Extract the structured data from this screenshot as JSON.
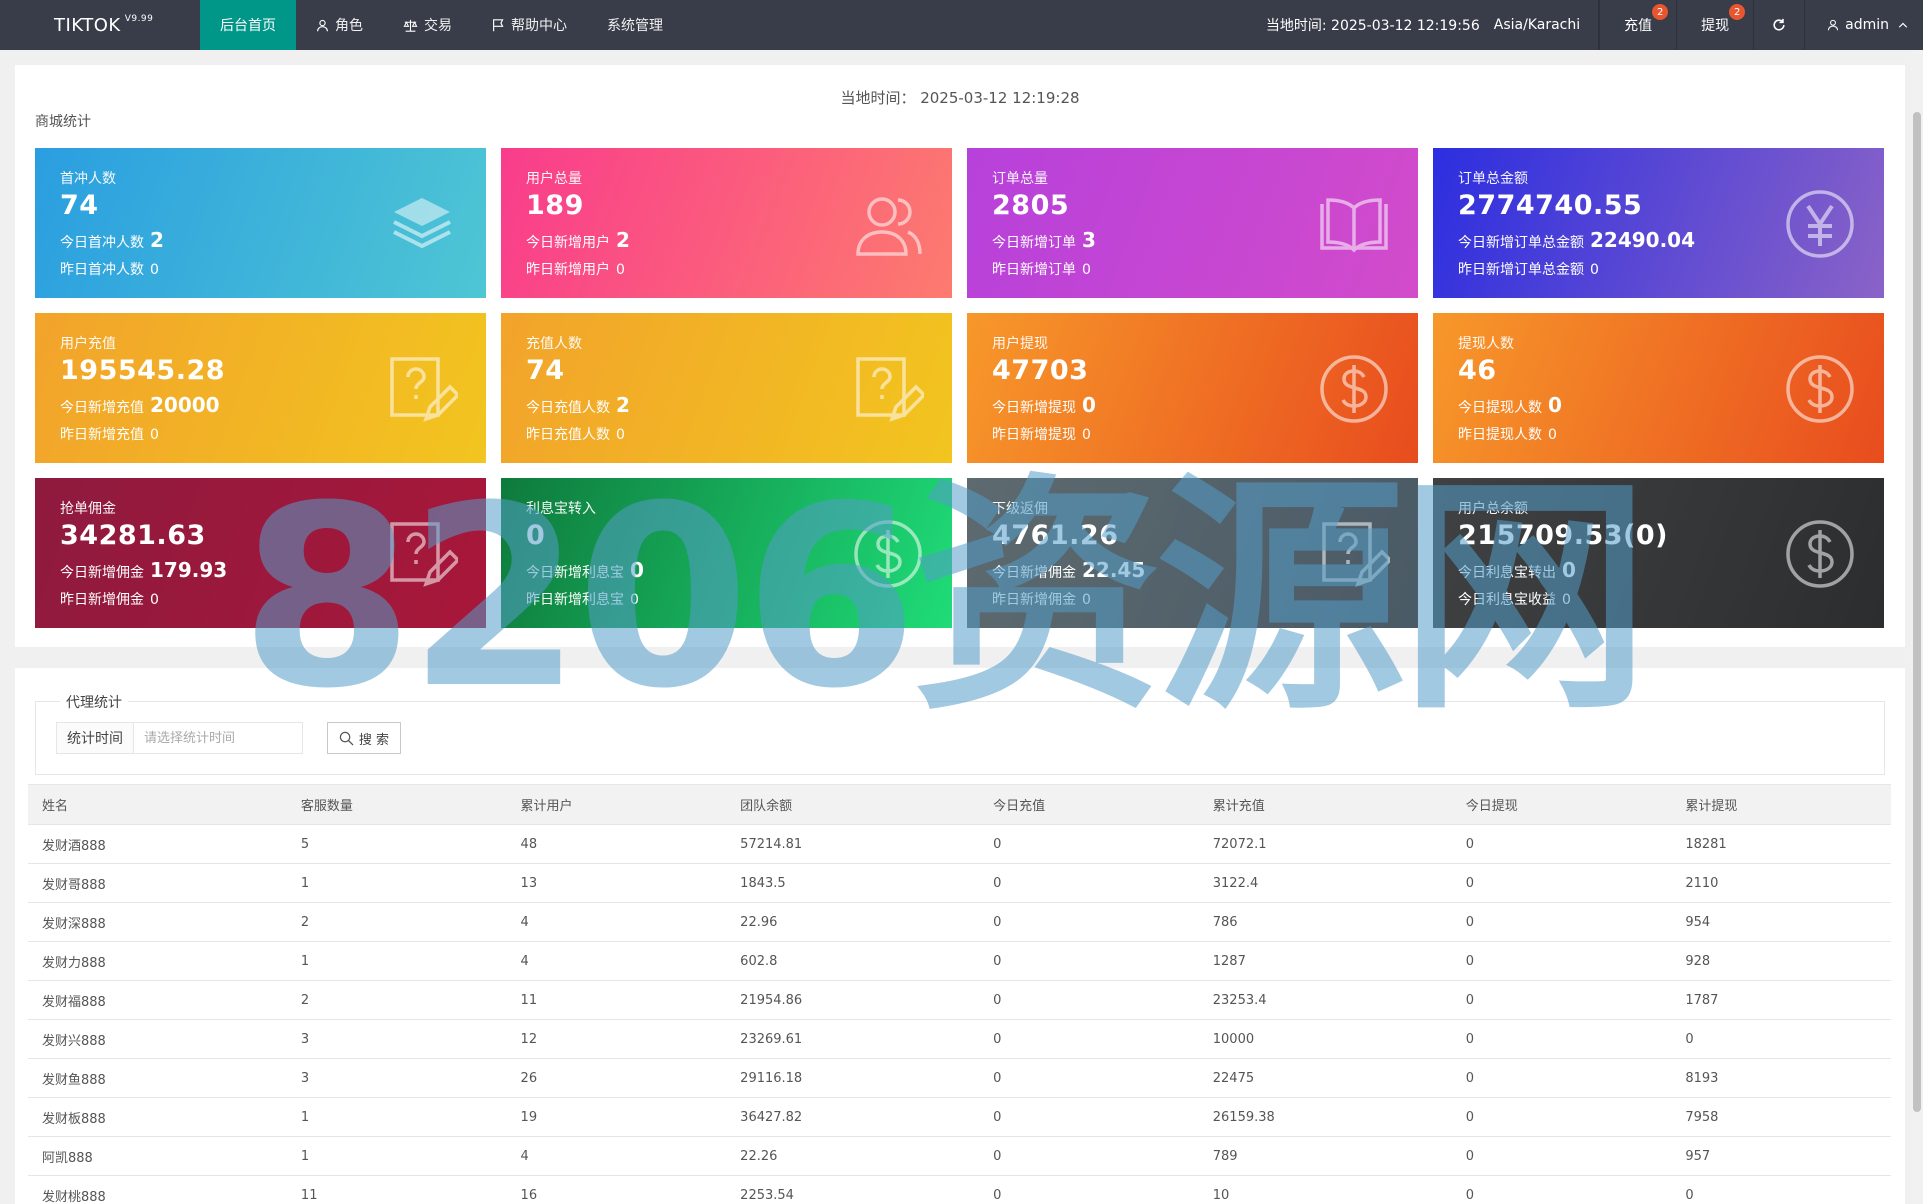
{
  "brand": {
    "name": "TIKTOK",
    "version": "V9.99"
  },
  "nav": [
    {
      "label": "后台首页",
      "icon": ""
    },
    {
      "label": "角色",
      "icon": "user-icon"
    },
    {
      "label": "交易",
      "icon": "scale-icon"
    },
    {
      "label": "帮助中心",
      "icon": "flag-icon"
    },
    {
      "label": "系统管理",
      "icon": ""
    }
  ],
  "header": {
    "time_label": "当地时间: 2025-03-12 12:19:56",
    "timezone": "Asia/Karachi",
    "recharge_label": "充值",
    "recharge_badge": "2",
    "withdraw_label": "提现",
    "withdraw_badge": "2",
    "user_label": "admin"
  },
  "panel": {
    "local_time": "当地时间： 2025-03-12 12:19:28",
    "section_title": "商城统计"
  },
  "cards": [
    {
      "label": "首冲人数",
      "value": "74",
      "line1_label": "今日首冲人数",
      "line1_value": "2",
      "line2_label": "昨日首冲人数",
      "line2_value": "0",
      "icon": "layers-icon"
    },
    {
      "label": "用户总量",
      "value": "189",
      "line1_label": "今日新增用户",
      "line1_value": "2",
      "line2_label": "昨日新增用户",
      "line2_value": "0",
      "icon": "users-icon"
    },
    {
      "label": "订单总量",
      "value": "2805",
      "line1_label": "今日新增订单",
      "line1_value": "3",
      "line2_label": "昨日新增订单",
      "line2_value": "0",
      "icon": "book-icon"
    },
    {
      "label": "订单总金额",
      "value": "2774740.55",
      "line1_label": "今日新增订单总金额",
      "line1_value": "22490.04",
      "line2_label": "昨日新增订单总金额",
      "line2_value": "0",
      "icon": "yen-icon"
    },
    {
      "label": "用户充值",
      "value": "195545.28",
      "line1_label": "今日新增充值",
      "line1_value": "20000",
      "line2_label": "昨日新增充值",
      "line2_value": "0",
      "icon": "edit-help-icon"
    },
    {
      "label": "充值人数",
      "value": "74",
      "line1_label": "今日充值人数",
      "line1_value": "2",
      "line2_label": "昨日充值人数",
      "line2_value": "0",
      "icon": "edit-help-icon"
    },
    {
      "label": "用户提现",
      "value": "47703",
      "line1_label": "今日新增提现",
      "line1_value": "0",
      "line2_label": "昨日新增提现",
      "line2_value": "0",
      "icon": "dollar-icon"
    },
    {
      "label": "提现人数",
      "value": "46",
      "line1_label": "今日提现人数",
      "line1_value": "0",
      "line2_label": "昨日提现人数",
      "line2_value": "0",
      "icon": "dollar-icon"
    },
    {
      "label": "抢单佣金",
      "value": "34281.63",
      "line1_label": "今日新增佣金",
      "line1_value": "179.93",
      "line2_label": "昨日新增佣金",
      "line2_value": "0",
      "icon": "edit-help-icon"
    },
    {
      "label": "利息宝转入",
      "value": "0",
      "line1_label": "今日新增利息宝",
      "line1_value": "0",
      "line2_label": "昨日新增利息宝",
      "line2_value": "0",
      "icon": "dollar-icon"
    },
    {
      "label": "下级返佣",
      "value": "4761.26",
      "line1_label": "今日新增佣金",
      "line1_value": "22.45",
      "line2_label": "昨日新增佣金",
      "line2_value": "0",
      "icon": "edit-help-icon"
    },
    {
      "label": "用户总余额",
      "value": "215709.53(0)",
      "line1_label": "今日利息宝转出",
      "line1_value": "0",
      "line2_label": "今日利息宝收益",
      "line2_value": "0",
      "icon": "dollar-icon"
    }
  ],
  "colors": {
    "card_gradients": [
      [
        "#2a9ee0",
        "#4fc6d4"
      ],
      [
        "#f93c8c",
        "#fd7b6f"
      ],
      [
        "#b741db",
        "#d24bcb"
      ],
      [
        "#2c2ee0",
        "#8a63c7"
      ],
      [
        "#f2a32b",
        "#f2c51f"
      ],
      [
        "#f2a32b",
        "#f2c51f"
      ],
      [
        "#f7982a",
        "#e84c1e"
      ],
      [
        "#f7982a",
        "#e84c1e"
      ],
      [
        "#8e1a3e",
        "#a8173a"
      ],
      [
        "#0e7a3c",
        "#1fdc78"
      ],
      [
        "#5d6a6f",
        "#4a5a66"
      ],
      [
        "#3f4143",
        "#2b2d2e"
      ]
    ],
    "topbar": "#393d49",
    "active_nav": "#009688",
    "badge": "#e8562f"
  },
  "agent_stats": {
    "legend": "代理统计",
    "filter_label": "统计时间",
    "filter_placeholder": "请选择统计时间",
    "search_label": "搜 索",
    "columns": [
      "姓名",
      "客服数量",
      "累计用户",
      "团队余额",
      "今日充值",
      "累计充值",
      "今日提现",
      "累计提现"
    ],
    "rows": [
      [
        "发财酒888",
        "5",
        "48",
        "57214.81",
        "0",
        "72072.1",
        "0",
        "18281"
      ],
      [
        "发财哥888",
        "1",
        "13",
        "1843.5",
        "0",
        "3122.4",
        "0",
        "2110"
      ],
      [
        "发财深888",
        "2",
        "4",
        "22.96",
        "0",
        "786",
        "0",
        "954"
      ],
      [
        "发财力888",
        "1",
        "4",
        "602.8",
        "0",
        "1287",
        "0",
        "928"
      ],
      [
        "发财福888",
        "2",
        "11",
        "21954.86",
        "0",
        "23253.4",
        "0",
        "1787"
      ],
      [
        "发财兴888",
        "3",
        "12",
        "23269.61",
        "0",
        "10000",
        "0",
        "0"
      ],
      [
        "发财鱼888",
        "3",
        "26",
        "29116.18",
        "0",
        "22475",
        "0",
        "8193"
      ],
      [
        "发财板888",
        "1",
        "19",
        "36427.82",
        "0",
        "26159.38",
        "0",
        "7958"
      ],
      [
        "阿凯888",
        "1",
        "4",
        "22.26",
        "0",
        "789",
        "0",
        "957"
      ],
      [
        "发财桃888",
        "11",
        "16",
        "2253.54",
        "0",
        "10",
        "0",
        "0"
      ]
    ]
  },
  "watermark": "8206资源网"
}
